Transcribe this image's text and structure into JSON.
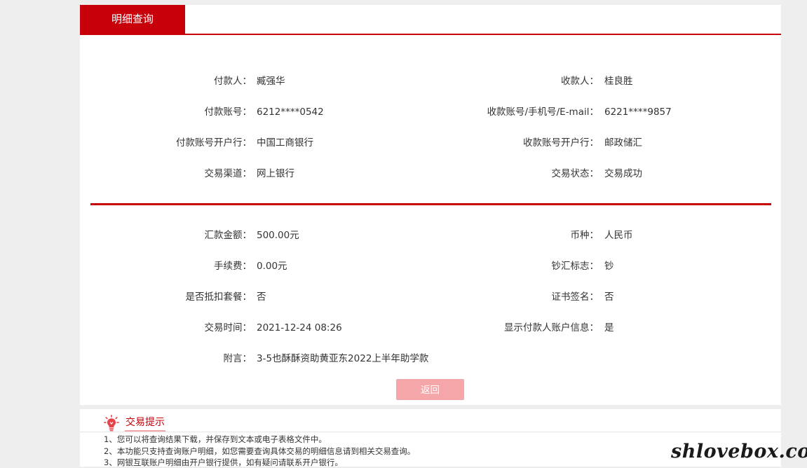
{
  "tab": {
    "title": "明细查询"
  },
  "payer": {
    "name_label": "付款人：",
    "name": "臧强华",
    "account_label": "付款账号：",
    "account": "6212****0542",
    "bank_label": "付款账号开户行：",
    "bank": "中国工商银行",
    "channel_label": "交易渠道：",
    "channel": "网上银行"
  },
  "payee": {
    "name_label": "收款人：",
    "name": "桂良胜",
    "account_label": "收款账号/手机号/E-mail：",
    "account": "6221****9857",
    "bank_label": "收款账号开户行：",
    "bank": "邮政储汇",
    "status_label": "交易状态：",
    "status": "交易成功"
  },
  "details": {
    "amount_label": "汇款金额：",
    "amount": "500.00元",
    "currency_label": "币种：",
    "currency": "人民币",
    "fee_label": "手续费：",
    "fee": "0.00元",
    "cash_flag_label": "钞汇标志：",
    "cash_flag": "钞",
    "package_label": "是否抵扣套餐：",
    "package": "否",
    "cert_label": "证书签名：",
    "cert": "否",
    "time_label": "交易时间：",
    "time": "2021-12-24 08:26",
    "show_payer_label": "显示付款人账户信息：",
    "show_payer": "是",
    "memo_label": "附言：",
    "memo": "3-5也酥酥资助黄亚东2022上半年助学款"
  },
  "buttons": {
    "back": "返回"
  },
  "tips": {
    "title": "交易提示",
    "items": [
      "1、您可以将查询结果下载，并保存到文本或电子表格文件中。",
      "2、本功能只支持查询账户明细，如您需要查询具体交易的明细信息请到相关交易查询。",
      "3、网银互联账户明细由开户银行提供，如有疑问请联系开户银行。"
    ]
  },
  "watermark": "shlovebox.com",
  "colors": {
    "accent": "#c8000a",
    "button_disabled": "#f4a6a9"
  },
  "icons": {
    "tips": "lightbulb-icon"
  }
}
